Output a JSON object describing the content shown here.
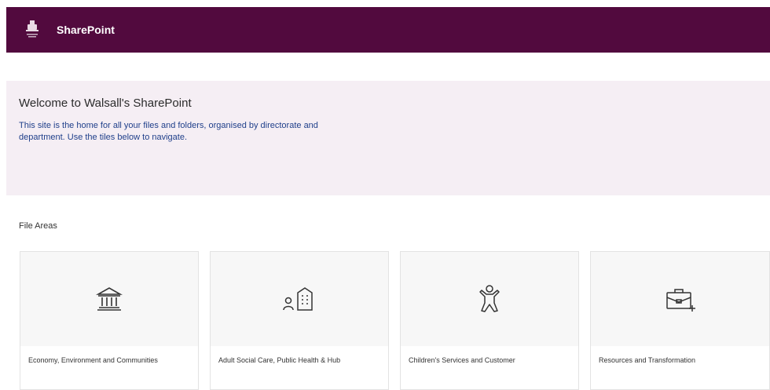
{
  "header": {
    "app_name": "SharePoint",
    "logo_icon": "council-crest-icon",
    "background": "#520a3e"
  },
  "welcome": {
    "title": "Welcome to Walsall's SharePoint",
    "body": "This site is the home for all your files and folders, organised by directorate and department. Use the tiles below to navigate."
  },
  "file_areas": {
    "label": "File Areas",
    "tiles": [
      {
        "label": "Economy, Environment and Communities",
        "icon": "bank-building-icon"
      },
      {
        "label": "Adult Social Care, Public Health & Hub",
        "icon": "person-building-icon"
      },
      {
        "label": "Children's Services and Customer",
        "icon": "person-figure-icon"
      },
      {
        "label": "Resources and Transformation",
        "icon": "briefcase-add-icon"
      }
    ]
  }
}
